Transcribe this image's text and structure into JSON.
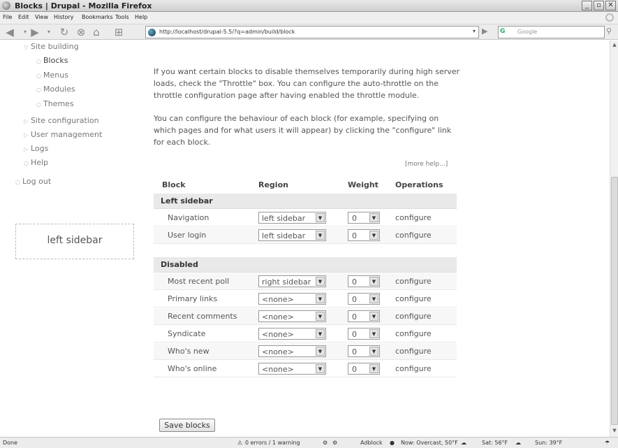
{
  "window": {
    "title": "Blocks | Drupal - Mozilla Firefox",
    "min": "_",
    "max": "▫",
    "close": "✕"
  },
  "menu": [
    "File",
    "Edit",
    "View",
    "History",
    "Bookmarks",
    "Tools",
    "Help"
  ],
  "toolbar": {
    "url": "http://localhost/drupal-5.5/?q=admin/build/block",
    "search_engine": "G",
    "search_placeholder": "Google"
  },
  "sidebar": {
    "items": [
      {
        "label": "Site building"
      },
      {
        "label": "Blocks"
      },
      {
        "label": "Menus"
      },
      {
        "label": "Modules"
      },
      {
        "label": "Themes"
      },
      {
        "label": "Site configuration"
      },
      {
        "label": "User management"
      },
      {
        "label": "Logs"
      },
      {
        "label": "Help"
      },
      {
        "label": "Log out"
      }
    ],
    "region_label": "left sidebar"
  },
  "main": {
    "para1": "If you want certain blocks to disable themselves temporarily during high server loads, check the \"Throttle\" box. You can configure the auto-throttle on the throttle configuration page after having enabled the throttle module.",
    "para2": "You can configure the behaviour of each block (for example, specifying on which pages and for what users it will appear) by clicking the \"configure\" link for each block.",
    "more_help": "[more help...]",
    "headers": {
      "block": "Block",
      "region": "Region",
      "weight": "Weight",
      "operations": "Operations"
    },
    "sections": [
      {
        "title": "Left sidebar",
        "rows": [
          {
            "name": "Navigation",
            "region": "left sidebar",
            "weight": "0",
            "op": "configure"
          },
          {
            "name": "User login",
            "region": "left sidebar",
            "weight": "0",
            "op": "configure"
          }
        ]
      },
      {
        "title": "Disabled",
        "rows": [
          {
            "name": "Most recent poll",
            "region": "right sidebar",
            "weight": "0",
            "op": "configure"
          },
          {
            "name": "Primary links",
            "region": "<none>",
            "weight": "0",
            "op": "configure"
          },
          {
            "name": "Recent comments",
            "region": "<none>",
            "weight": "0",
            "op": "configure"
          },
          {
            "name": "Syndicate",
            "region": "<none>",
            "weight": "0",
            "op": "configure"
          },
          {
            "name": "Who's new",
            "region": "<none>",
            "weight": "0",
            "op": "configure"
          },
          {
            "name": "Who's online",
            "region": "<none>",
            "weight": "0",
            "op": "configure"
          }
        ]
      }
    ],
    "save_label": "Save blocks"
  },
  "status": {
    "done": "Done",
    "errors": "0 errors / 1 warning",
    "adblock": "Adblock",
    "weather_now": "Now: Overcast, 50°F",
    "weather_sat": "Sat: 56°F",
    "weather_sun": "Sun: 39°F"
  }
}
